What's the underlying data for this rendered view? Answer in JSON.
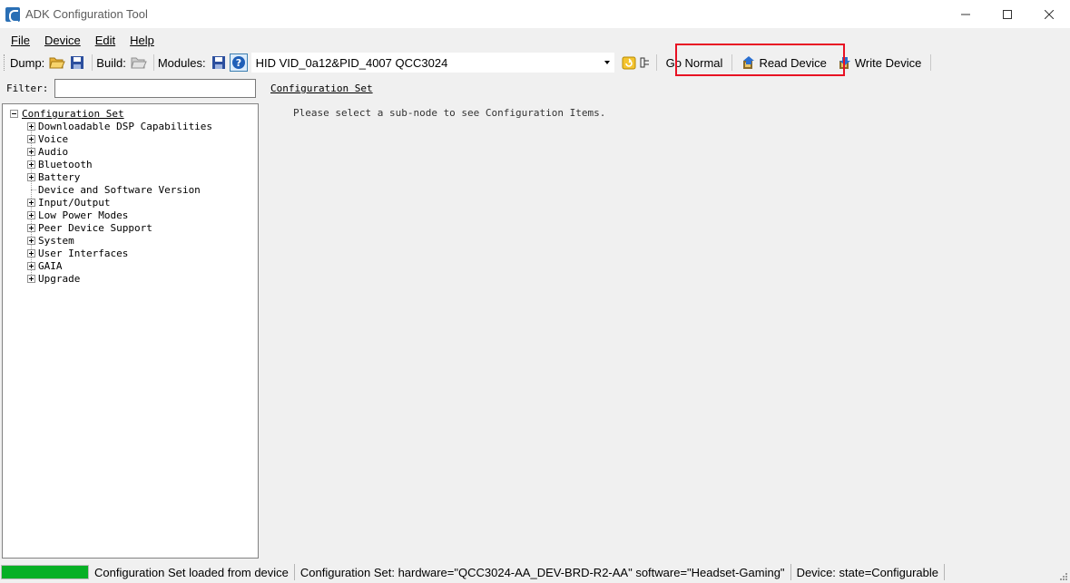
{
  "window": {
    "title": "ADK Configuration Tool"
  },
  "menu": {
    "items": [
      {
        "label": "File"
      },
      {
        "label": "Device"
      },
      {
        "label": "Edit"
      },
      {
        "label": "Help"
      }
    ]
  },
  "toolbar": {
    "dump_label": "Dump:",
    "build_label": "Build:",
    "modules_label": "Modules:",
    "device_combo_value": "HID VID_0a12&PID_4007 QCC3024",
    "go_normal_label": "Go Normal",
    "read_device_label": "Read Device",
    "write_device_label": "Write Device"
  },
  "filter": {
    "label": "Filter:",
    "value": ""
  },
  "tree": {
    "root_label": "Configuration Set",
    "items": [
      {
        "label": "Downloadable DSP Capabilities",
        "expandable": true
      },
      {
        "label": "Voice",
        "expandable": true
      },
      {
        "label": "Audio",
        "expandable": true
      },
      {
        "label": "Bluetooth",
        "expandable": true
      },
      {
        "label": "Battery",
        "expandable": true
      },
      {
        "label": "Device and Software Version",
        "expandable": false
      },
      {
        "label": "Input/Output",
        "expandable": true
      },
      {
        "label": "Low Power Modes",
        "expandable": true
      },
      {
        "label": "Peer Device Support",
        "expandable": true
      },
      {
        "label": "System",
        "expandable": true
      },
      {
        "label": "User Interfaces",
        "expandable": true
      },
      {
        "label": "GAIA",
        "expandable": true
      },
      {
        "label": "Upgrade",
        "expandable": true
      }
    ]
  },
  "content": {
    "title": "Configuration Set",
    "message": "Please select a sub-node to see Configuration Items."
  },
  "status": {
    "progress_fraction": 1.0,
    "loaded_text": "Configuration Set loaded from device",
    "config_set_text": "Configuration Set:  hardware=\"QCC3024-AA_DEV-BRD-R2-AA\" software=\"Headset-Gaming\"",
    "device_text": "Device:  state=Configurable"
  },
  "colors": {
    "progress": "#06b025",
    "highlight": "#e81123",
    "active_icon_border": "#3c7fb1"
  }
}
